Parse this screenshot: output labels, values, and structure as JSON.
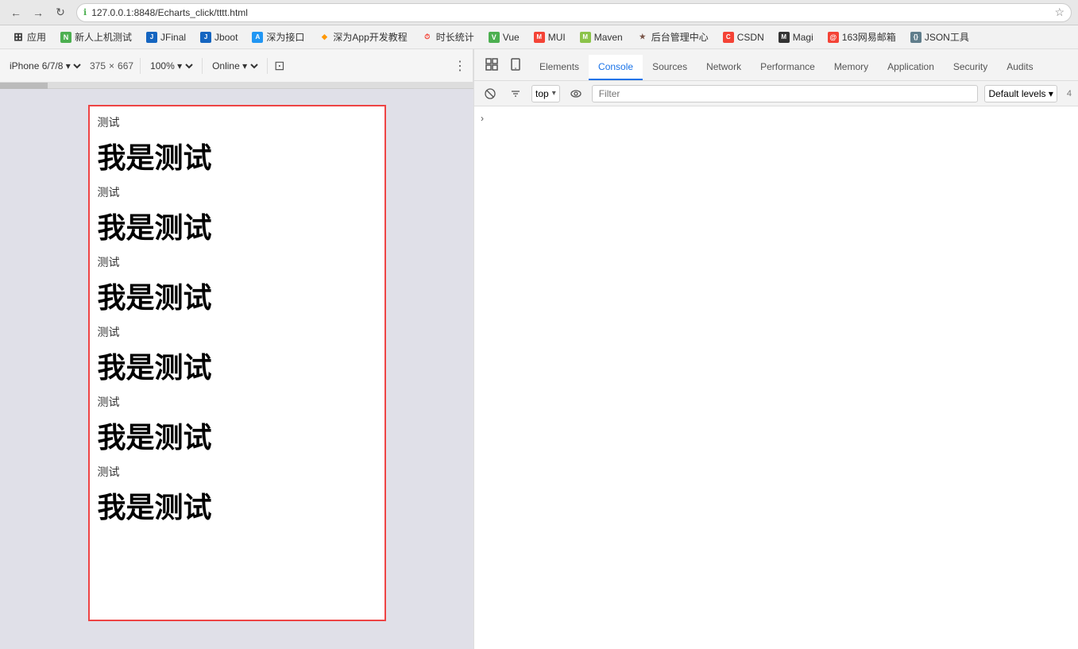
{
  "browser": {
    "url": "127.0.0.1:8848/Echarts_click/tttt.html",
    "back_label": "←",
    "forward_label": "→",
    "reload_label": "↻",
    "star_label": "☆"
  },
  "bookmarks": [
    {
      "label": "应用",
      "icon": "⊞",
      "icon_color": "#888"
    },
    {
      "label": "新人上机测试",
      "icon": "N",
      "icon_color": "#4CAF50"
    },
    {
      "label": "JFinal",
      "icon": "J",
      "icon_color": "#1565C0"
    },
    {
      "label": "Jboot",
      "icon": "J",
      "icon_color": "#1565C0"
    },
    {
      "label": "深为接口",
      "icon": "A",
      "icon_color": "#2196F3"
    },
    {
      "label": "深为App开发教程",
      "icon": "◆",
      "icon_color": "#FF9800"
    },
    {
      "label": "时长统计",
      "icon": "⏱",
      "icon_color": "#F44336"
    },
    {
      "label": "Vue",
      "icon": "V",
      "icon_color": "#4CAF50"
    },
    {
      "label": "MUI",
      "icon": "M",
      "icon_color": "#F44336"
    },
    {
      "label": "Maven",
      "icon": "M",
      "icon_color": "#8BC34A"
    },
    {
      "label": "后台管理中心",
      "icon": "★",
      "icon_color": "#795548"
    },
    {
      "label": "CSDN",
      "icon": "C",
      "icon_color": "#F44336"
    },
    {
      "label": "Magi",
      "icon": "M",
      "icon_color": "#333"
    },
    {
      "label": "163网易邮箱",
      "icon": "@",
      "icon_color": "#F44336"
    },
    {
      "label": "JSON工具",
      "icon": "{}",
      "icon_color": "#607D8B"
    }
  ],
  "device_toolbar": {
    "device": "iPhone 6/7/8 ▾",
    "width": "375",
    "x": "×",
    "height": "667",
    "zoom": "100% ▾",
    "online": "Online ▾"
  },
  "page_content": {
    "items": [
      {
        "small": "测试",
        "large": "我是测试"
      },
      {
        "small": "测试",
        "large": "我是测试"
      },
      {
        "small": "测试",
        "large": "我是测试"
      },
      {
        "small": "测试",
        "large": "我是测试"
      },
      {
        "small": "测试",
        "large": "我是测试"
      },
      {
        "small": "测试",
        "large": "我是测试"
      }
    ]
  },
  "devtools": {
    "tabs": [
      {
        "label": "Elements",
        "active": false
      },
      {
        "label": "Console",
        "active": true
      },
      {
        "label": "Sources",
        "active": false
      },
      {
        "label": "Network",
        "active": false
      },
      {
        "label": "Performance",
        "active": false
      },
      {
        "label": "Memory",
        "active": false
      },
      {
        "label": "Application",
        "active": false
      },
      {
        "label": "Security",
        "active": false
      },
      {
        "label": "Audits",
        "active": false
      }
    ],
    "console_toolbar": {
      "context": "top",
      "filter_placeholder": "Filter",
      "levels": "Default levels ▾"
    },
    "console_arrow": "›"
  }
}
